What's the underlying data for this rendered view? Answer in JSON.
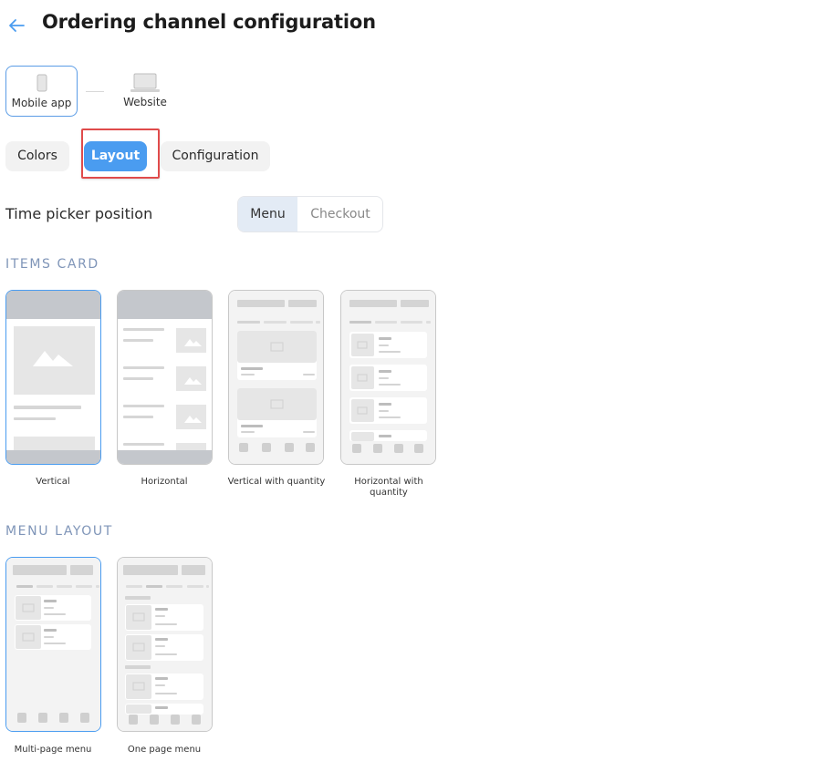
{
  "header": {
    "title": "Ordering channel configuration",
    "back_icon": "arrow-left-icon"
  },
  "channels": [
    {
      "label": "Mobile app",
      "icon": "mobile-phone-icon",
      "selected": true
    },
    {
      "label": "Website",
      "icon": "laptop-icon",
      "selected": false
    }
  ],
  "subtabs": {
    "colors": "Colors",
    "layout": "Layout",
    "configuration": "Configuration",
    "active": "Layout"
  },
  "time_picker": {
    "label": "Time picker position",
    "options": [
      "Menu",
      "Checkout"
    ],
    "selected": "Menu"
  },
  "items_card": {
    "title": "ITEMS CARD",
    "options": [
      {
        "label": "Vertical",
        "selected": true
      },
      {
        "label": "Horizontal",
        "selected": false
      },
      {
        "label": "Vertical with quantity",
        "selected": false
      },
      {
        "label": "Horizontal with quantity",
        "selected": false
      }
    ]
  },
  "menu_layout": {
    "title": "MENU LAYOUT",
    "options": [
      {
        "label": "Multi-page menu",
        "selected": true
      },
      {
        "label": "One page menu",
        "selected": false
      }
    ]
  },
  "colors": {
    "accent": "#4a9cf0",
    "highlight": "#e04b4b",
    "section_title": "#7f95b8"
  }
}
